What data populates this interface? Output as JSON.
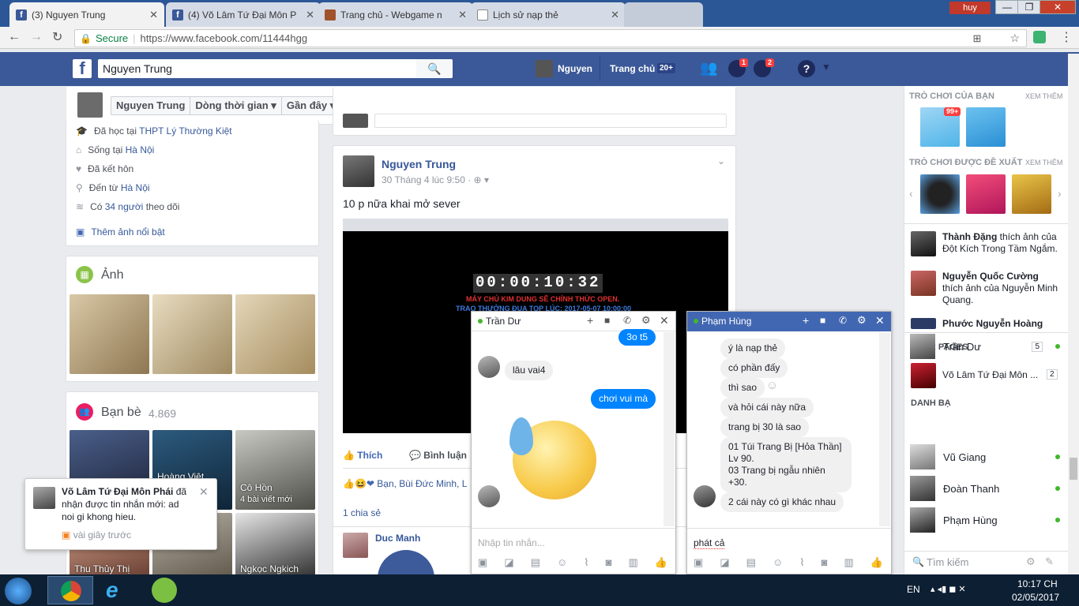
{
  "browser": {
    "tabs": [
      {
        "title": "(3) Nguyen Trung",
        "active": true
      },
      {
        "title": "(4) Võ Lâm Tứ Đại Môn P",
        "active": false
      },
      {
        "title": "Trang chủ - Webgame n",
        "active": false
      },
      {
        "title": "Lịch sử nạp thẻ",
        "active": false
      }
    ],
    "user": "huy",
    "secure_label": "Secure",
    "url": "https://www.facebook.com/11444hgg"
  },
  "fb": {
    "search_value": "Nguyen Trung",
    "profile_name": "Nguyen",
    "home_label": "Trang chủ",
    "home_count": "20+",
    "messages_badge": "1",
    "notif_badge": "2"
  },
  "profile_bar": {
    "name": "Nguyen Trung",
    "timeline": "Dòng thời gian",
    "recent": "Gần đây"
  },
  "intro": {
    "studied": "Đã học tại",
    "school": "THPT Lý Thường Kiệt",
    "lives": "Sống tại",
    "city": "Hà Nội",
    "married": "Đã kết hôn",
    "from": "Đến từ",
    "from_city": "Hà Nội",
    "followers_pre": "Có",
    "followers_count": "34 người",
    "followers_post": "theo dõi",
    "add_featured": "Thêm ảnh nổi bật"
  },
  "photos": {
    "title": "Ảnh"
  },
  "friends": {
    "title": "Bạn bè",
    "count": "4.869",
    "items": [
      "Hoàng Việt",
      "Cô Hồn",
      "Thu Thủy Thị",
      "Ngkọc Ngkich"
    ],
    "co_hon_posts": "4 bài viết mới"
  },
  "post": {
    "author": "Nguyen Trung",
    "time": "30 Tháng 4 lúc 9:50",
    "text": "10 p nữa khai mở sever",
    "countdown": "00:00:10:32",
    "countdown_line1": "MÁY CHỦ KIM DUNG SẼ CHÍNH THỨC OPEN.",
    "countdown_line2": "TRAO THƯỞNG ĐUA TOP LÚC: 2017-05-07 10:00:00",
    "like": "Thích",
    "comment": "Bình luận",
    "reactions": "Bạn, Bùi Đức Minh, L",
    "shares": "1 chia sẻ",
    "commenter": "Duc Manh"
  },
  "notification": {
    "page": "Võ Lâm Tứ Đại Môn Phái",
    "text": "đã nhận được tin nhắn mới: ad noi gi khong hieu.",
    "time": "vài giây trước"
  },
  "chat1": {
    "name": "Trần Dư",
    "messages": [
      "3o t5",
      "lâu vai4",
      "chơi vui mà"
    ],
    "placeholder": "Nhập tin nhắn..."
  },
  "chat2": {
    "name": "Phạm Hùng",
    "messages": [
      "ý là nạp thẻ",
      "có phần đấy",
      "thì sao",
      "và hỏi cái này nữa",
      "trang bị 30 là sao",
      "01 Túi Trang Bị [Hỏa Thần] Lv 90.\n03 Trang bị ngẫu nhiên +30.",
      "2 cái này có gì khác nhau"
    ],
    "input_value": "phát cả"
  },
  "sidebar": {
    "games_title": "TRÒ CHƠI CỦA BẠN",
    "see_all": "XEM THÊM",
    "game_badge": "99+",
    "suggested_title": "TRÒ CHƠI ĐƯỢC ĐỀ XUẤT",
    "see_all2": "XEM THÊM",
    "ticker": [
      {
        "name": "Thành Đặng",
        "text": "thích ảnh của Đột Kích Trong Tầm Ngắm."
      },
      {
        "name": "Nguyễn Quốc Cường",
        "text": "thích ảnh của Nguyễn Minh Quang."
      },
      {
        "name": "Phước Nguyễn Hoàng",
        "text": ""
      }
    ],
    "your_pages": "YOUR PAGES",
    "page_name": "Võ Lâm Tứ Đại Môn ...",
    "page_count": "2",
    "list_title": "DANH BẠ",
    "contacts": [
      {
        "name": "Trần Dư",
        "count": "5"
      },
      {
        "name": "Vũ Giang",
        "count": ""
      },
      {
        "name": "Đoàn Thanh",
        "count": ""
      },
      {
        "name": "Phạm Hùng",
        "count": ""
      }
    ],
    "search_placeholder": "Tìm kiếm"
  },
  "taskbar": {
    "lang": "EN",
    "time": "10:17 CH",
    "date": "02/05/2017"
  }
}
